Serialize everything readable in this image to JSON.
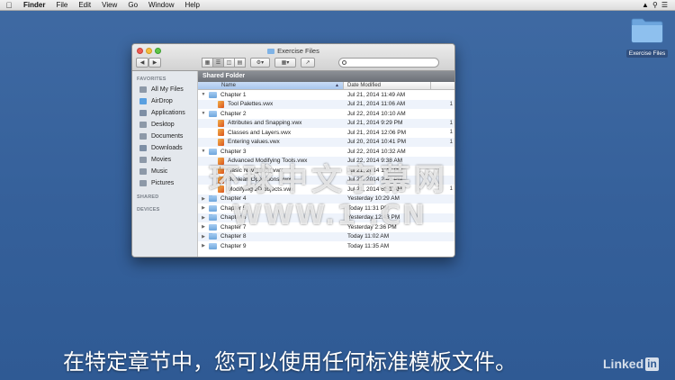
{
  "menubar": {
    "items": [
      "Finder",
      "File",
      "Edit",
      "View",
      "Go",
      "Window",
      "Help"
    ]
  },
  "desktop": {
    "folder_label": "Exercise Files"
  },
  "window": {
    "title": "Exercise Files",
    "search_placeholder": ""
  },
  "sidebar": {
    "favorites_heading": "FAVORITES",
    "favorites": [
      {
        "label": "All My Files",
        "icon": "all-files-icon",
        "color": "#8d99a8"
      },
      {
        "label": "AirDrop",
        "icon": "airdrop-icon",
        "color": "#5aa0e0"
      },
      {
        "label": "Applications",
        "icon": "applications-icon",
        "color": "#7e8fa5"
      },
      {
        "label": "Desktop",
        "icon": "desktop-icon",
        "color": "#8d99a8"
      },
      {
        "label": "Documents",
        "icon": "documents-icon",
        "color": "#8d99a8"
      },
      {
        "label": "Downloads",
        "icon": "downloads-icon",
        "color": "#7e8fa5"
      },
      {
        "label": "Movies",
        "icon": "movies-icon",
        "color": "#8d99a8"
      },
      {
        "label": "Music",
        "icon": "music-icon",
        "color": "#8d99a8"
      },
      {
        "label": "Pictures",
        "icon": "pictures-icon",
        "color": "#8d99a8"
      }
    ],
    "shared_heading": "SHARED",
    "devices_heading": "DEVICES"
  },
  "content": {
    "path_header": "Shared Folder",
    "col_name": "Name",
    "col_date": "Date Modified",
    "rows": [
      {
        "type": "folder",
        "expanded": true,
        "name": "Chapter 1",
        "date": "Jul 21, 2014 11:49 AM",
        "extra": ""
      },
      {
        "type": "file",
        "name": "Tool Palettes.vwx",
        "date": "Jul 21, 2014 11:06 AM",
        "extra": "1"
      },
      {
        "type": "folder",
        "expanded": true,
        "name": "Chapter 2",
        "date": "Jul 22, 2014 10:10 AM",
        "extra": ""
      },
      {
        "type": "file",
        "name": "Attributes and Snapping.vwx",
        "date": "Jul 21, 2014 9:29 PM",
        "extra": "1"
      },
      {
        "type": "file",
        "name": "Classes and Layers.vwx",
        "date": "Jul 21, 2014 12:06 PM",
        "extra": "1"
      },
      {
        "type": "file",
        "name": "Entering values.vwx",
        "date": "Jul 20, 2014 10:41 PM",
        "extra": "1"
      },
      {
        "type": "folder",
        "expanded": true,
        "name": "Chapter 3",
        "date": "Jul 22, 2014 10:32 AM",
        "extra": ""
      },
      {
        "type": "file",
        "name": "Advanced Modifying Tools.vwx",
        "date": "Jul 22, 2014 9:38 AM",
        "extra": ""
      },
      {
        "type": "file",
        "name": "Basic Navigation.vwx",
        "date": "Jul 21, 2014 1:47 PM",
        "extra": ""
      },
      {
        "type": "file",
        "name": "Boolean Operations.vwx",
        "date": "Jul 21, 2014 2:49 PM",
        "extra": ""
      },
      {
        "type": "file",
        "name": "Modifying 2D objects.vwx",
        "date": "Jul 21, 2014 6:51 AM",
        "extra": "1"
      },
      {
        "type": "folder",
        "expanded": false,
        "name": "Chapter 4",
        "date": "Yesterday 10:29 AM",
        "extra": ""
      },
      {
        "type": "folder",
        "expanded": false,
        "name": "Chapter 5",
        "date": "Today 11:31 PM",
        "extra": ""
      },
      {
        "type": "folder",
        "expanded": false,
        "name": "Chapter 6",
        "date": "Yesterday 12:43 PM",
        "extra": ""
      },
      {
        "type": "folder",
        "expanded": false,
        "name": "Chapter 7",
        "date": "Yesterday 2:36 PM",
        "extra": ""
      },
      {
        "type": "folder",
        "expanded": false,
        "name": "Chapter 8",
        "date": "Today 11:02 AM",
        "extra": ""
      },
      {
        "type": "folder",
        "expanded": false,
        "name": "Chapter 9",
        "date": "Today 11:35 AM",
        "extra": ""
      }
    ]
  },
  "overlay": {
    "watermark_line1": "环球中文字幕网",
    "watermark_line2": "WWW.1  .CN"
  },
  "subtitle": "在特定章节中，您可以使用任何标准模板文件。",
  "branding": {
    "linked": "Linked",
    "in": "in"
  }
}
